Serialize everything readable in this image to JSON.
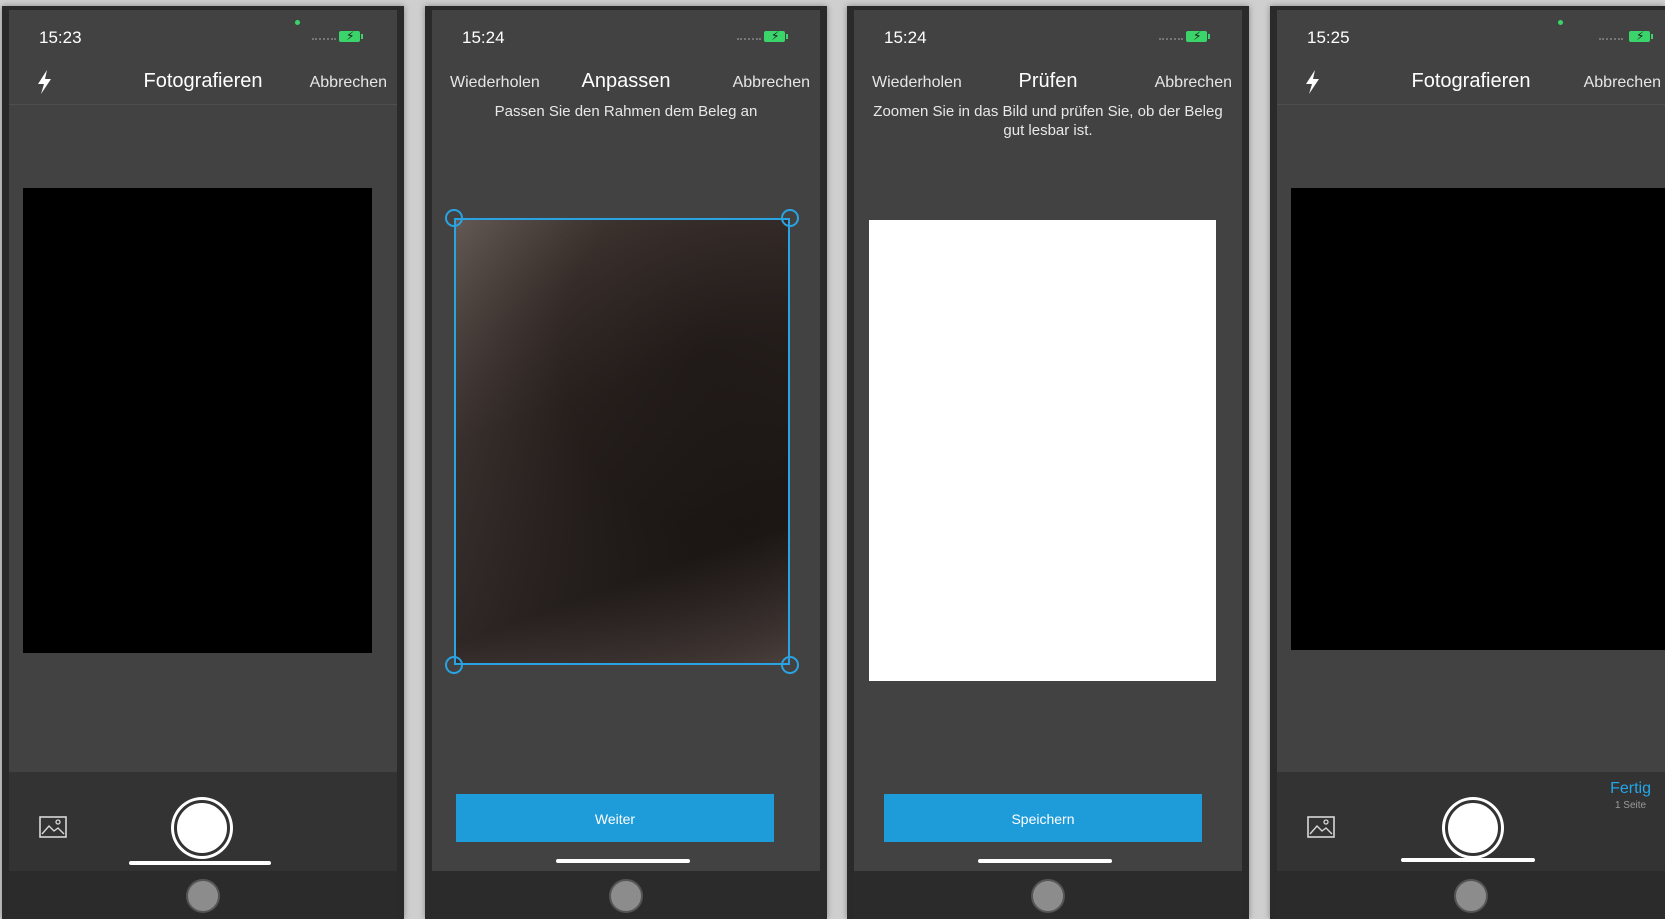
{
  "colors": {
    "accent": "#1e9bd9",
    "frame": "#2aa3e3",
    "panel": "#424242",
    "battery": "#3ad46a"
  },
  "screens": [
    {
      "time": "15:23",
      "title": "Fotografieren",
      "right": "Abbrechen",
      "left_icon": "flash-icon",
      "gallery_icon": "gallery-icon"
    },
    {
      "time": "15:24",
      "title": "Anpassen",
      "left": "Wiederholen",
      "right": "Abbrechen",
      "hint": "Passen Sie den Rahmen dem Beleg an",
      "button": "Weiter"
    },
    {
      "time": "15:24",
      "title": "Prüfen",
      "left": "Wiederholen",
      "right": "Abbrechen",
      "hint": "Zoomen Sie in das Bild und prüfen Sie, ob der Beleg gut lesbar ist.",
      "button": "Speichern"
    },
    {
      "time": "15:25",
      "title": "Fotografieren",
      "right": "Abbrechen",
      "left_icon": "flash-icon",
      "gallery_icon": "gallery-icon",
      "done": "Fertig",
      "done_sub": "1 Seite"
    }
  ]
}
